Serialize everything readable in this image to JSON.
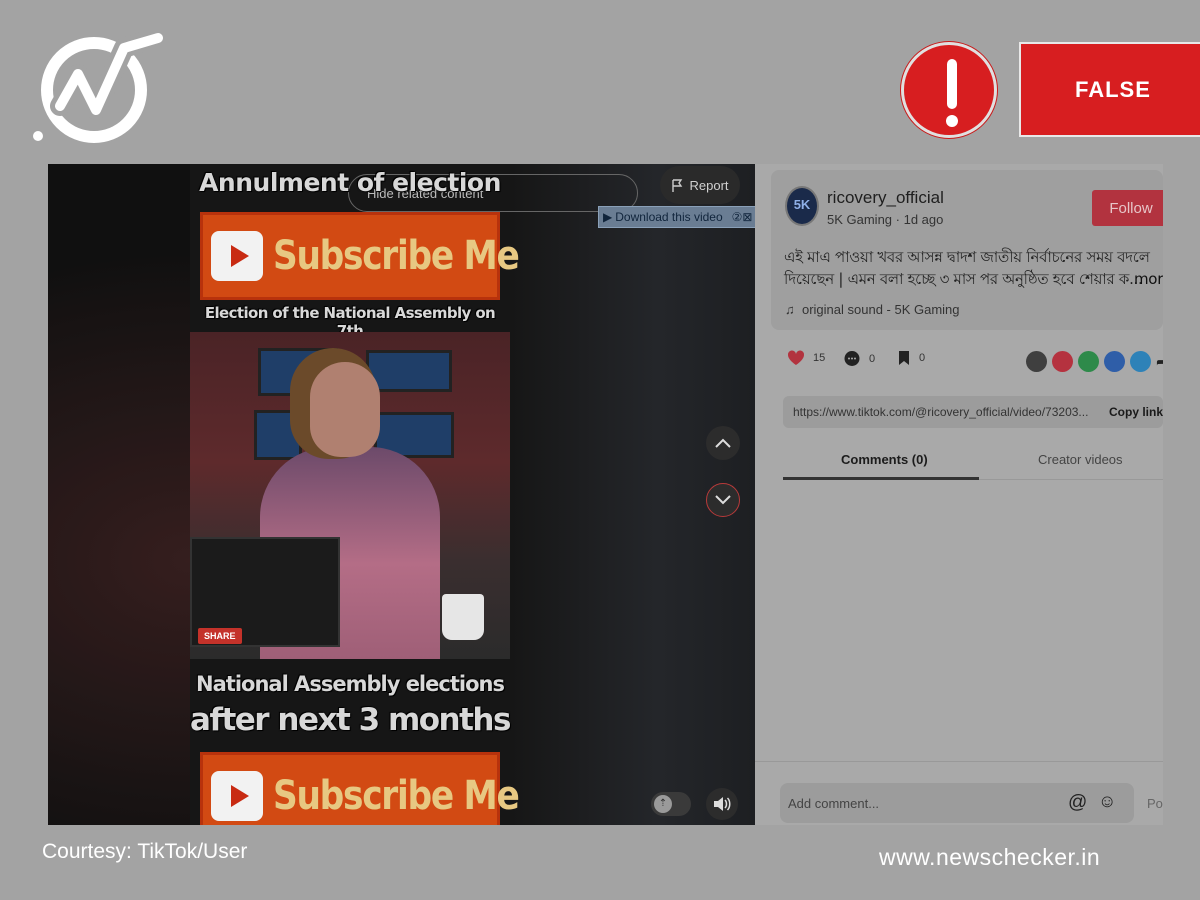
{
  "badge": {
    "verdict": "FALSE",
    "alert_icon": "exclamation-icon"
  },
  "brand": {
    "logo_icon": "newschecker-check-icon"
  },
  "video": {
    "report_label": "Report",
    "download_label": "Download this video",
    "download_extra": "②⊠",
    "hidden_pill": "Hide related content",
    "caption_top": "Annulment of election",
    "subscribe_text": "Subscribe Me",
    "caption_sub": "Election of the National Assembly on 7th",
    "share_tag": "SHARE",
    "caption_bottom1": "National Assembly elections",
    "caption_bottom2": "after next 3 months",
    "subscribe_text2": "Subscribe Me"
  },
  "post": {
    "avatar_text": "5K",
    "username": "ricovery_official",
    "meta": "5K Gaming · 1d ago",
    "follow_label": "Follow",
    "description": "এই মাএ পাওয়া খবর আসন্ন দ্বাদশ জাতীয় নির্বাচনের সময় বদলে দিয়েছেন | এমন বলা হচ্ছে ৩ মাস পর অনুষ্ঠিত হবে শেয়ার ক...",
    "more_label": "more",
    "sound": "original sound - 5K Gaming",
    "likes": "15",
    "comments": "0",
    "saves": "0",
    "link": "https://www.tiktok.com/@ricovery_official/video/73203...",
    "copy_label": "Copy link",
    "tab_comments": "Comments (0)",
    "tab_creator": "Creator videos",
    "comment_placeholder": "Add comment...",
    "post_label": "Po"
  },
  "footer": {
    "courtesy": "Courtesy: TikTok/User",
    "site": "www.newschecker.in"
  },
  "colors": {
    "alert_red": "#d71e20",
    "follow_red": "#b2333f",
    "overlay_gray": "#a3a3a3"
  }
}
